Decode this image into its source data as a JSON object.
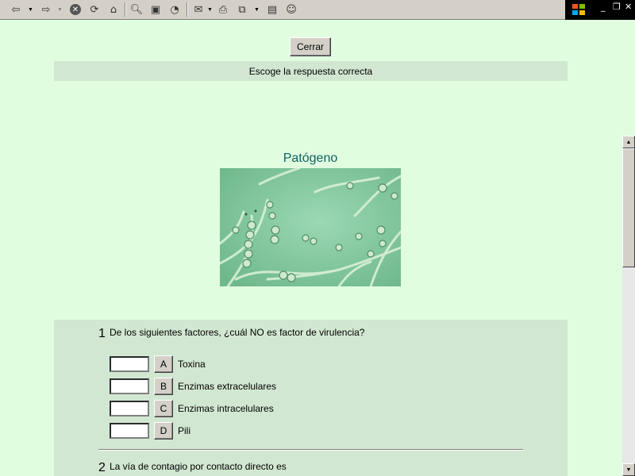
{
  "toolbar": {
    "buttons": [
      "back-icon",
      "forward-icon",
      "stop-icon",
      "refresh-icon",
      "home-icon",
      "search-icon",
      "favorites-icon",
      "history-icon",
      "mail-icon",
      "print-icon",
      "edit-icon",
      "discuss-icon",
      "messenger-icon"
    ],
    "win_minimize": "_",
    "win_restore": "❐",
    "win_close": "✕"
  },
  "page": {
    "close_label": "Cerrar",
    "instruction": "Escoge la respuesta correcta",
    "pathogen_title": "Patógeno"
  },
  "questions": [
    {
      "number": "1",
      "text": "De los siguientes factores, ¿cuál NO es factor de virulencia?",
      "options": [
        {
          "letter": "A",
          "text": "Toxina"
        },
        {
          "letter": "B",
          "text": "Enzimas extracelulares"
        },
        {
          "letter": "C",
          "text": "Enzimas intracelulares"
        },
        {
          "letter": "D",
          "text": "Pili"
        }
      ]
    },
    {
      "number": "2",
      "text": "La vía de contagio por contacto directo es"
    }
  ],
  "scrollbar": {
    "up": "▲",
    "down": "▼"
  },
  "colors": {
    "page_bg": "#e0fde0",
    "panel_bg": "#d2e7d2",
    "title_color": "#0f6161"
  }
}
